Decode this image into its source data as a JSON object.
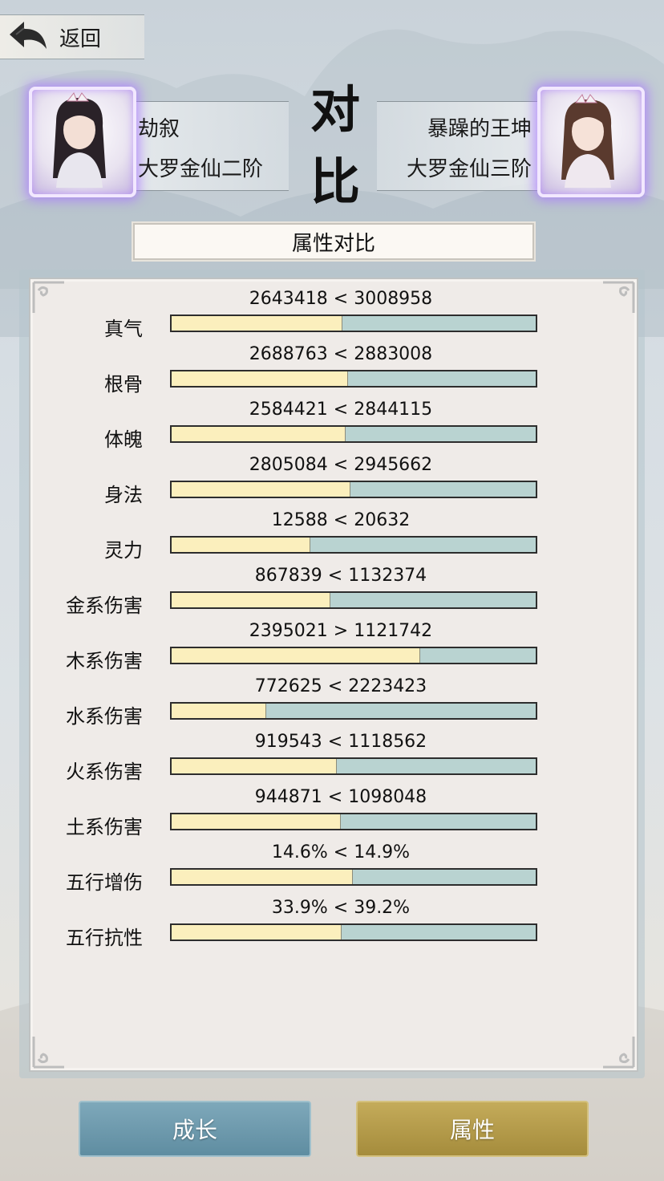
{
  "nav": {
    "back_label": "返回"
  },
  "header": {
    "title_line1": "对",
    "title_line2": "比",
    "left_player": {
      "name": "劫叙",
      "rank": "大罗金仙二阶"
    },
    "right_player": {
      "name": "暴躁的王坤",
      "rank": "大罗金仙三阶"
    }
  },
  "section": {
    "title": "属性对比"
  },
  "stats": [
    {
      "label": "真气",
      "value": "2643418 < 3008958",
      "ratio": 0.468
    },
    {
      "label": "根骨",
      "value": "2688763 < 2883008",
      "ratio": 0.483
    },
    {
      "label": "体魄",
      "value": "2584421 < 2844115",
      "ratio": 0.476
    },
    {
      "label": "身法",
      "value": "2805084 < 2945662",
      "ratio": 0.488
    },
    {
      "label": "灵力",
      "value": "12588 < 20632",
      "ratio": 0.379
    },
    {
      "label": "金系伤害",
      "value": "867839 < 1132374",
      "ratio": 0.434
    },
    {
      "label": "木系伤害",
      "value": "2395021 > 1121742",
      "ratio": 0.681
    },
    {
      "label": "水系伤害",
      "value": "772625 < 2223423",
      "ratio": 0.258
    },
    {
      "label": "火系伤害",
      "value": "919543 < 1118562",
      "ratio": 0.451
    },
    {
      "label": "土系伤害",
      "value": "944871 < 1098048",
      "ratio": 0.462
    },
    {
      "label": "五行增伤",
      "value": "14.6% < 14.9%",
      "ratio": 0.495
    },
    {
      "label": "五行抗性",
      "value": "33.9% < 39.2%",
      "ratio": 0.464
    }
  ],
  "buttons": {
    "growth": "成长",
    "attributes": "属性"
  },
  "colors": {
    "bar_left": "#fbefbd",
    "bar_right": "#b9d3d1",
    "btn_growth": "#6f9aae",
    "btn_attr": "#b59b4a"
  }
}
